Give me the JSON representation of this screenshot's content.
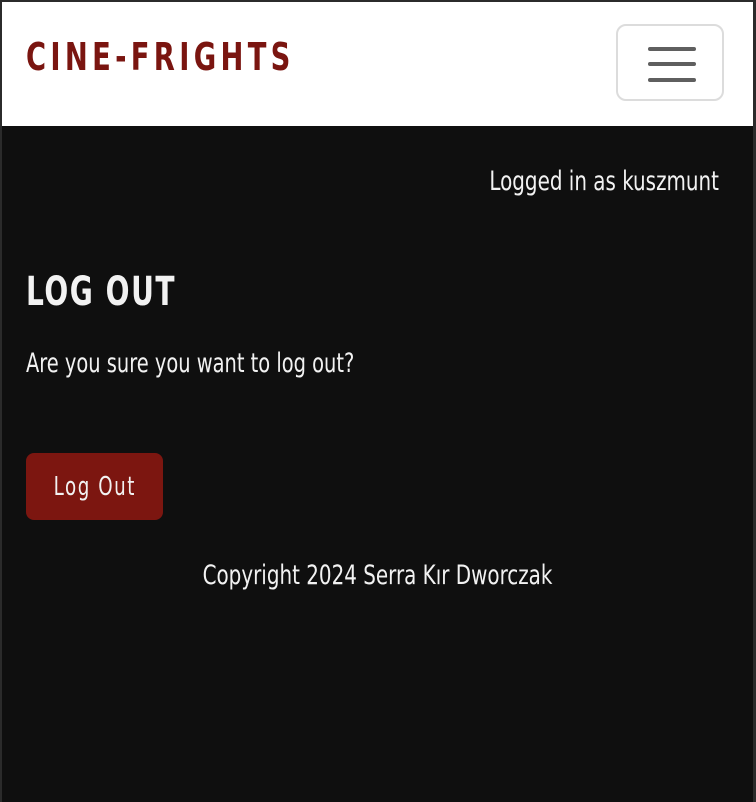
{
  "navbar": {
    "brand": "CINE-FRIGHTS",
    "toggler_icon": "hamburger-menu-icon"
  },
  "session": {
    "status_text": "Logged in as kuszmunt"
  },
  "main": {
    "title": "LOG OUT",
    "confirm_text": "Are you sure you want to log out?",
    "logout_button_label": "Log Out"
  },
  "footer": {
    "copyright": "Copyright 2024 Serra Kır Dworczak"
  },
  "colors": {
    "brand": "#7a1510",
    "background": "#0f0f0f",
    "button": "#7c1610",
    "text": "#f2f2f2"
  }
}
